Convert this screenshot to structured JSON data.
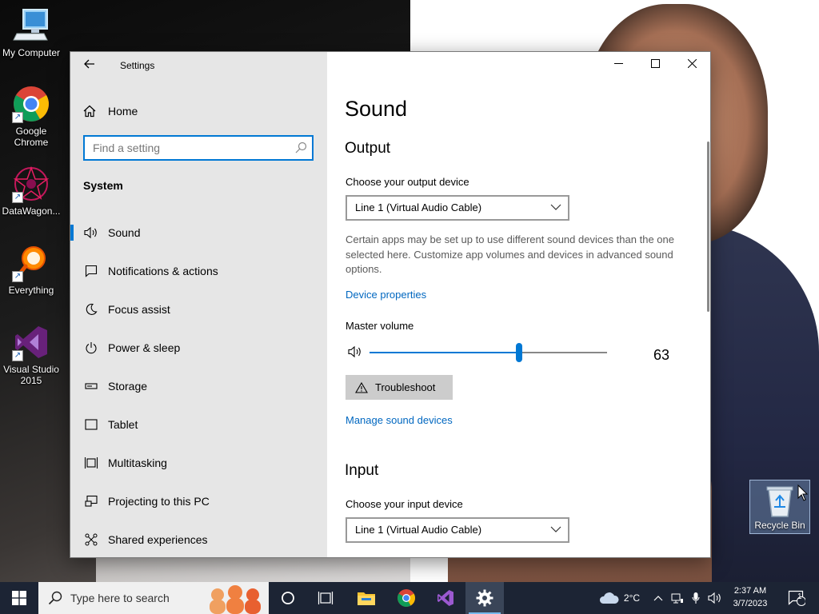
{
  "desktop": {
    "icons": [
      {
        "label": "My Computer"
      },
      {
        "label": "Google\nChrome"
      },
      {
        "label": "DataWagon..."
      },
      {
        "label": "Everything"
      },
      {
        "label": "Visual Studio\n2015"
      }
    ],
    "recycle_bin": {
      "label": "Recycle Bin"
    }
  },
  "window": {
    "title": "Settings",
    "sidebar": {
      "home_label": "Home",
      "search_placeholder": "Find a setting",
      "group_label": "System",
      "items": [
        {
          "label": "Sound",
          "icon": "speaker-icon",
          "active": true
        },
        {
          "label": "Notifications & actions",
          "icon": "notification-icon"
        },
        {
          "label": "Focus assist",
          "icon": "moon-icon"
        },
        {
          "label": "Power & sleep",
          "icon": "power-icon"
        },
        {
          "label": "Storage",
          "icon": "storage-icon"
        },
        {
          "label": "Tablet",
          "icon": "tablet-icon"
        },
        {
          "label": "Multitasking",
          "icon": "multitasking-icon"
        },
        {
          "label": "Projecting to this PC",
          "icon": "projecting-icon"
        },
        {
          "label": "Shared experiences",
          "icon": "shared-icon"
        }
      ]
    },
    "content": {
      "page_title": "Sound",
      "output": {
        "heading": "Output",
        "device_label": "Choose your output device",
        "device_value": "Line 1 (Virtual Audio Cable)",
        "description": "Certain apps may be set up to use different sound devices than the one selected here. Customize app volumes and devices in advanced sound options.",
        "device_properties_link": "Device properties",
        "master_volume_label": "Master volume",
        "volume": 63,
        "troubleshoot_label": "Troubleshoot",
        "manage_link": "Manage sound devices"
      },
      "input": {
        "heading": "Input",
        "device_label": "Choose your input device",
        "device_value": "Line 1 (Virtual Audio Cable)"
      }
    }
  },
  "taskbar": {
    "search_placeholder": "Type here to search",
    "weather": "2°C",
    "time": "2:37 AM",
    "date": "3/7/2023",
    "notification_count": "1"
  },
  "colors": {
    "accent": "#0078d4",
    "link": "#0067c0",
    "sidebar_bg": "#e6e6e6",
    "taskbar_bg": "#1c2434"
  }
}
